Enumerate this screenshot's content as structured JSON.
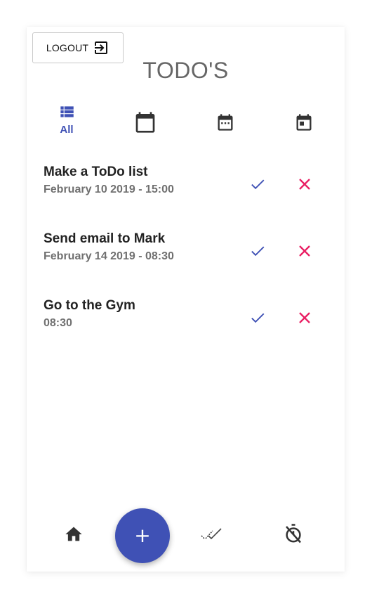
{
  "header": {
    "logout_label": "LOGOUT",
    "logout_icon": "exit-to-app-icon",
    "title": "TODO'S"
  },
  "filters": {
    "active_color": "#3f51b5",
    "tabs": [
      {
        "label": "All",
        "icon": "list-icon",
        "active": true
      },
      {
        "label": "",
        "icon": "calendar-icon",
        "active": false
      },
      {
        "label": "",
        "icon": "calendar-week-icon",
        "active": false
      },
      {
        "label": "",
        "icon": "calendar-today-icon",
        "active": false
      }
    ]
  },
  "todos": [
    {
      "title": "Make a ToDo list",
      "time": "February 10 2019 - 15:00"
    },
    {
      "title": "Send email to Mark",
      "time": "February 14 2019 - 08:30"
    },
    {
      "title": "Go to the Gym",
      "time": "08:30"
    }
  ],
  "actions": {
    "complete_icon": "check-icon",
    "complete_color": "#3f51b5",
    "delete_icon": "close-icon",
    "delete_color": "#e91e63"
  },
  "bottom_nav": {
    "home_icon": "home-icon",
    "add_label": "+",
    "add_color": "#3f51b5",
    "done_icon": "done-all-icon",
    "timer_icon": "timer-off-icon"
  }
}
